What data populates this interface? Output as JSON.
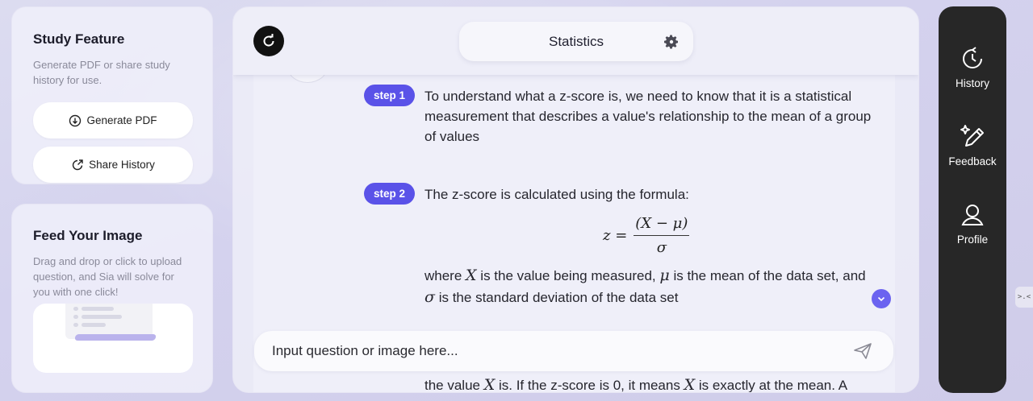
{
  "study": {
    "title": "Study Feature",
    "description": "Generate PDF or share study history for use.",
    "generate_pdf": "Generate PDF",
    "share_history": "Share History"
  },
  "feed": {
    "title": "Feed Your Image",
    "description": "Drag and drop or click to upload question, and Sia will solve for you with one click!"
  },
  "header": {
    "title": "Statistics"
  },
  "steps": [
    {
      "badge": "step 1",
      "text": "To understand what a z-score is, we need to know that it is a statistical measurement that describes a value's relationship to the mean of a group of values"
    },
    {
      "badge": "step 2",
      "text": "The z-score is calculated using the formula:"
    }
  ],
  "formula": {
    "lhs": "z =",
    "numerator": "(X − μ)",
    "denominator": "σ"
  },
  "where": {
    "p1": "where ",
    "x": "X",
    "p2": " is the value being measured, ",
    "mu": "μ",
    "p3": " is the mean of the data set, and ",
    "sigma": "σ",
    "p4": " is the standard deviation of the data set"
  },
  "overflow": {
    "p1": "the value ",
    "x1": "X",
    "p2": " is. If the z-score is 0, it means ",
    "x2": "X",
    "p3": " is exactly at the mean. A"
  },
  "input": {
    "placeholder": "Input question or image here..."
  },
  "nav": {
    "history": "History",
    "feedback": "Feedback",
    "profile": "Profile"
  },
  "toggle": ">.<"
}
